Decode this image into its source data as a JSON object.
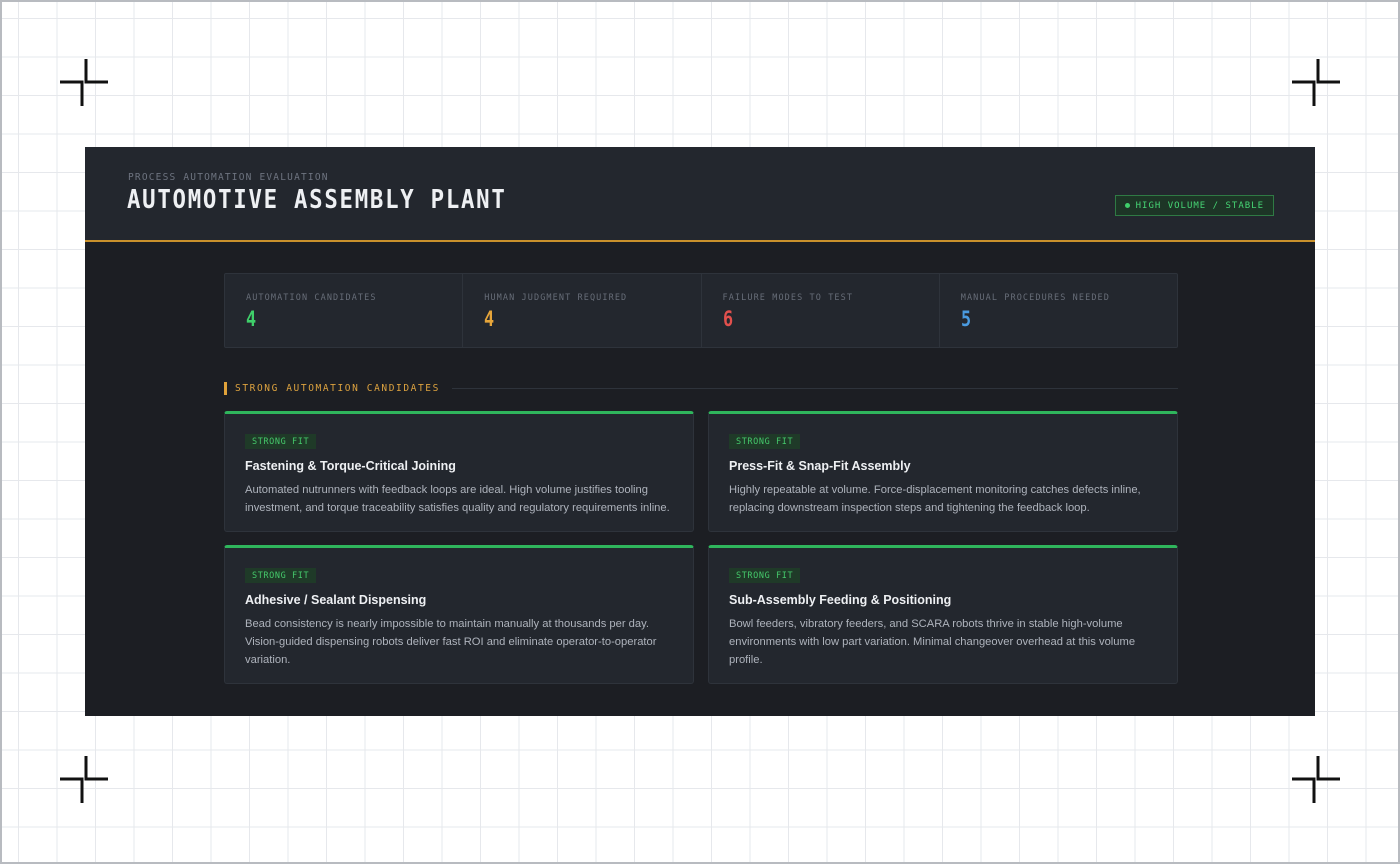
{
  "header": {
    "eyebrow": "PROCESS AUTOMATION EVALUATION",
    "title": "AUTOMOTIVE ASSEMBLY PLANT",
    "status": "HIGH VOLUME / STABLE"
  },
  "stats": [
    {
      "label": "AUTOMATION CANDIDATES",
      "value": "4",
      "color": "#3fcf6a"
    },
    {
      "label": "HUMAN JUDGMENT REQUIRED",
      "value": "4",
      "color": "#e6a53a"
    },
    {
      "label": "FAILURE MODES TO TEST",
      "value": "6",
      "color": "#e2504d"
    },
    {
      "label": "MANUAL PROCEDURES NEEDED",
      "value": "5",
      "color": "#4a9be0"
    }
  ],
  "section": {
    "title": "STRONG AUTOMATION CANDIDATES"
  },
  "cards": [
    {
      "tag": "STRONG FIT",
      "title": "Fastening & Torque-Critical Joining",
      "description": "Automated nutrunners with feedback loops are ideal. High volume justifies tooling investment, and torque traceability satisfies quality and regulatory requirements inline."
    },
    {
      "tag": "STRONG FIT",
      "title": "Press-Fit & Snap-Fit Assembly",
      "description": "Highly repeatable at volume. Force-displacement monitoring catches defects inline, replacing downstream inspection steps and tightening the feedback loop."
    },
    {
      "tag": "STRONG FIT",
      "title": "Adhesive / Sealant Dispensing",
      "description": "Bead consistency is nearly impossible to maintain manually at thousands per day. Vision-guided dispensing robots deliver fast ROI and eliminate operator-to-operator variation."
    },
    {
      "tag": "STRONG FIT",
      "title": "Sub-Assembly Feeding & Positioning",
      "description": "Bowl feeders, vibratory feeders, and SCARA robots thrive in stable high-volume environments with low part variation. Minimal changeover overhead at this volume profile."
    }
  ]
}
